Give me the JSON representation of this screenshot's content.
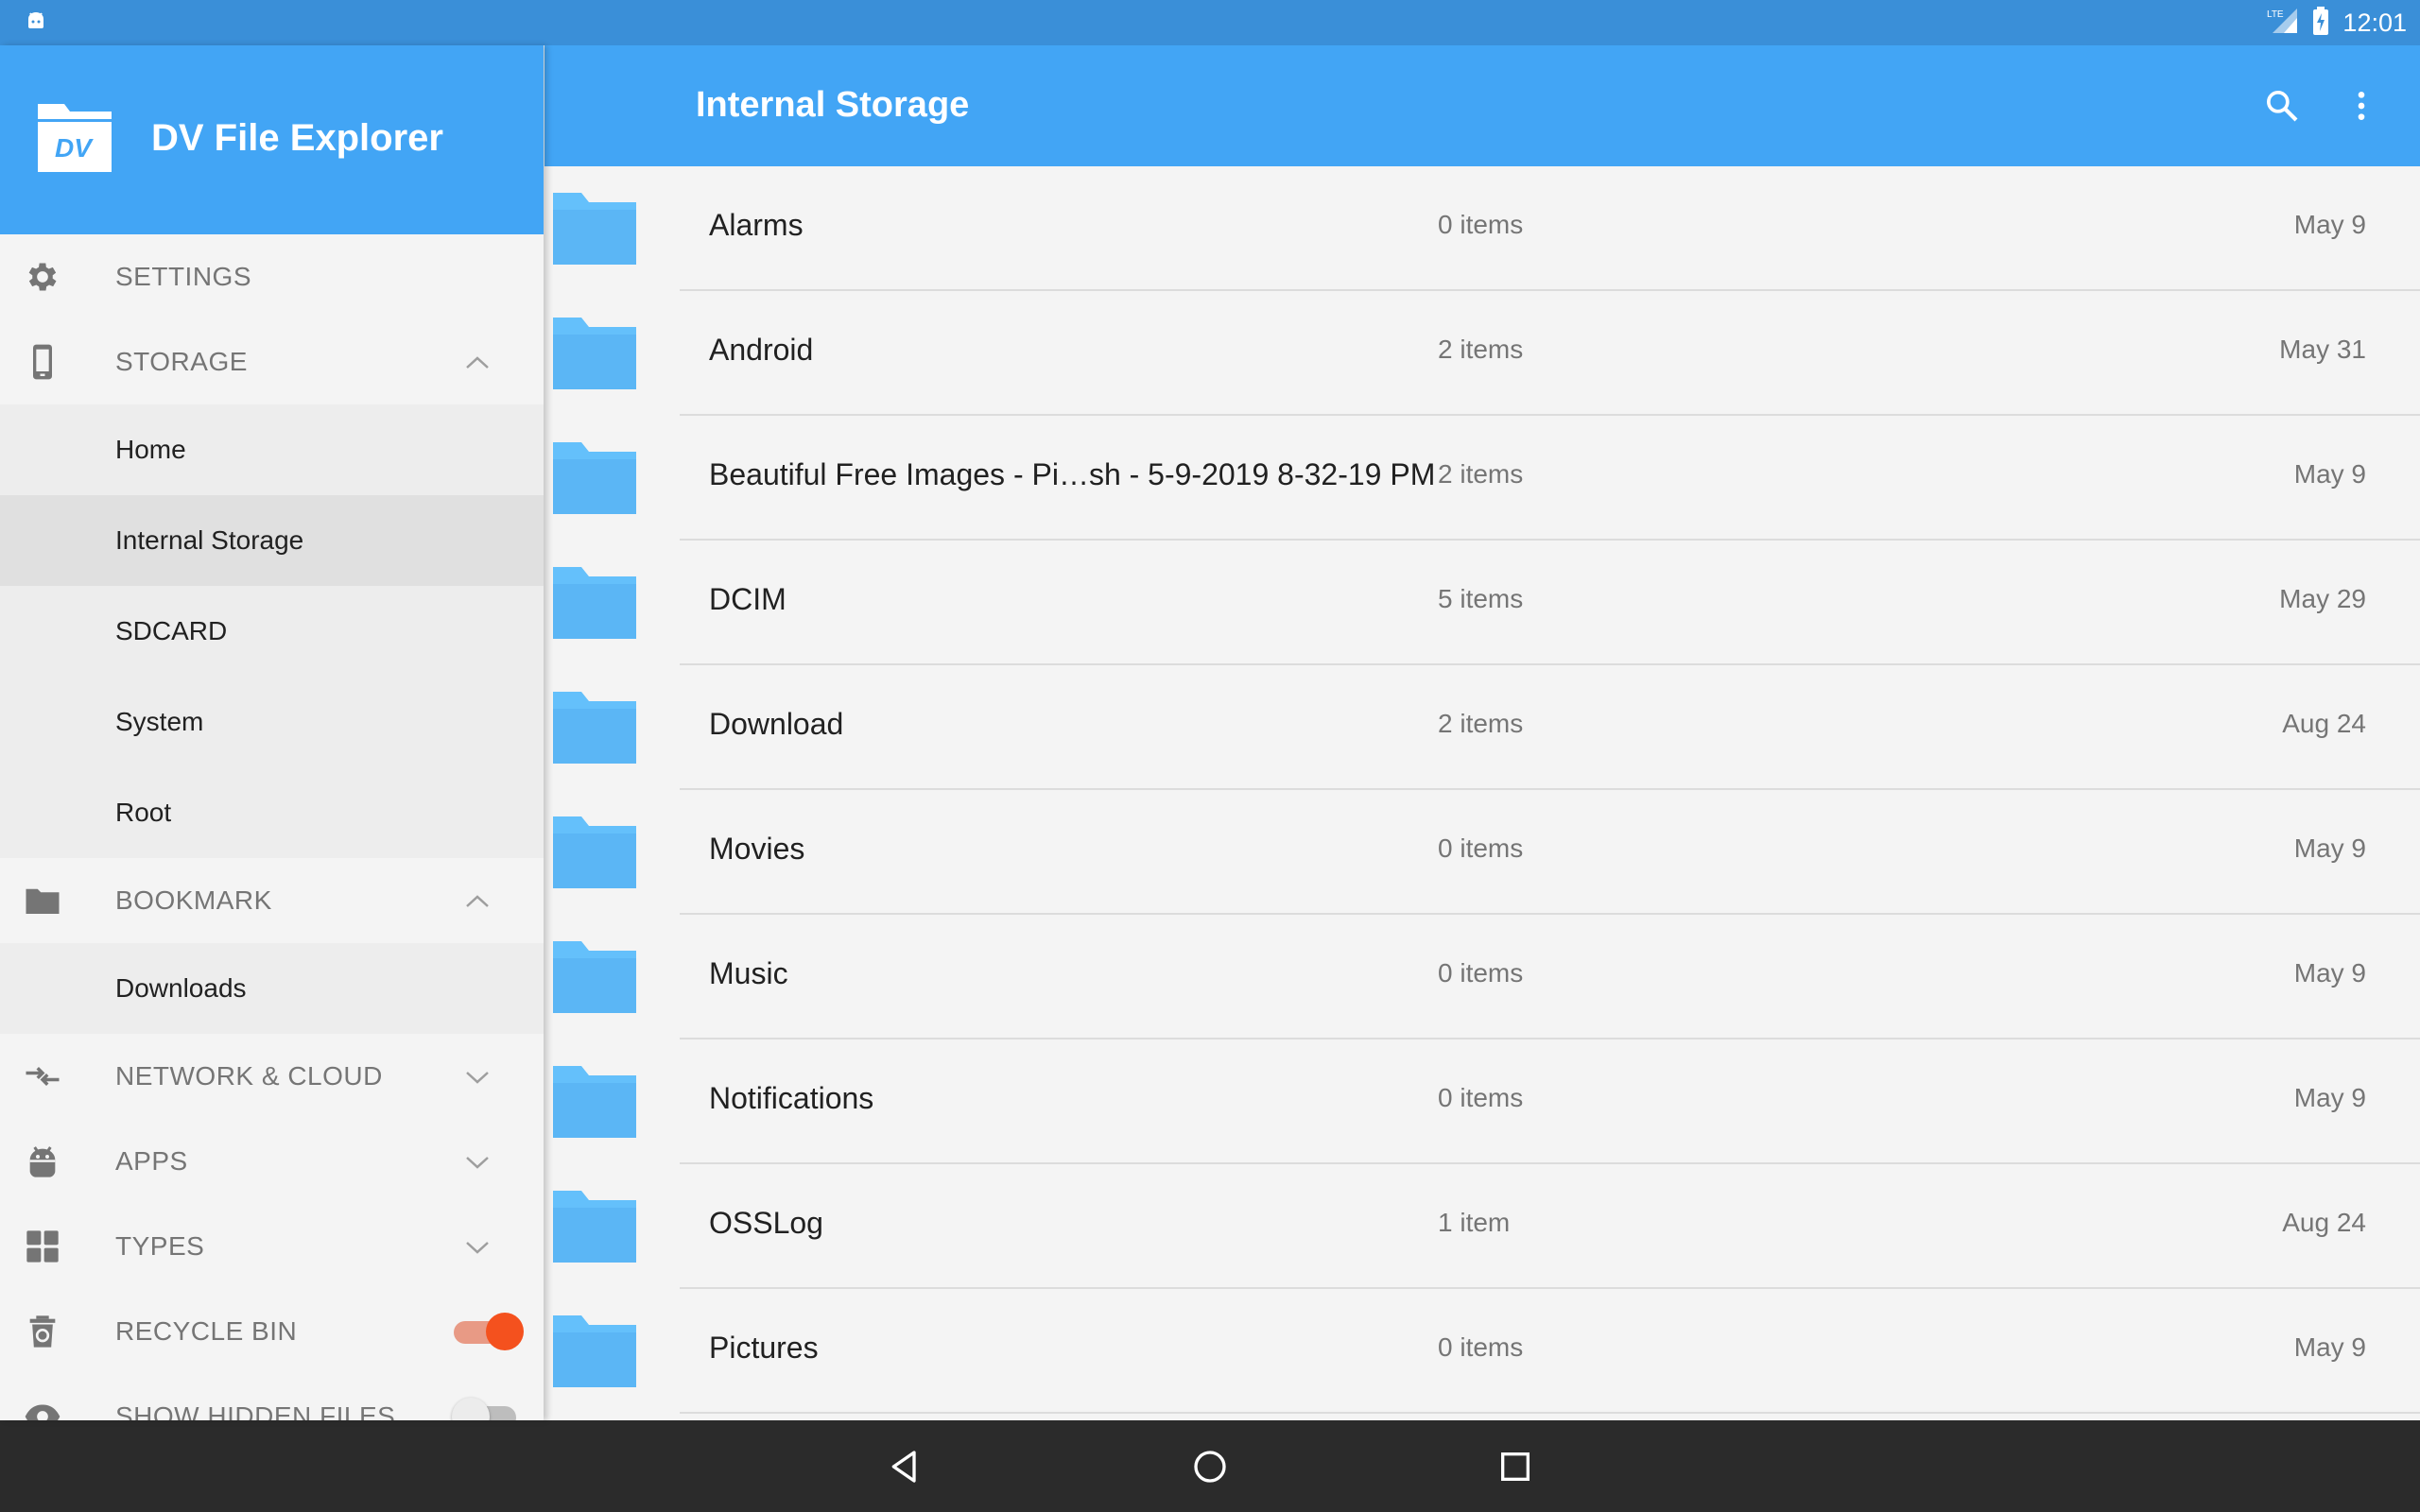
{
  "status_bar": {
    "time": "12:01",
    "network": "LTE",
    "icons": [
      "android-icon",
      "signal-icon",
      "battery-icon"
    ]
  },
  "app": {
    "name": "DV File Explorer",
    "logo_text": "DV"
  },
  "drawer": {
    "settings": "SETTINGS",
    "storage": {
      "label": "STORAGE",
      "items": [
        "Home",
        "Internal Storage",
        "SDCARD",
        "System",
        "Root"
      ],
      "selected": "Internal Storage"
    },
    "bookmark": {
      "label": "BOOKMARK",
      "items": [
        "Downloads"
      ]
    },
    "network": "NETWORK & CLOUD",
    "apps": "APPS",
    "types": "TYPES",
    "recycle_bin": {
      "label": "RECYCLE BIN",
      "enabled": true
    },
    "show_hidden": {
      "label": "SHOW HIDDEN FILES",
      "enabled": false
    }
  },
  "toolbar": {
    "title": "Internal Storage",
    "icons": [
      "search-icon",
      "more-vert-icon"
    ]
  },
  "files": [
    {
      "name": "Alarms",
      "count": "0 items",
      "date": "May 9"
    },
    {
      "name": "Android",
      "count": "2 items",
      "date": "May 31"
    },
    {
      "name": "Beautiful Free Images - Pi…sh - 5-9-2019 8-32-19 PM",
      "count": "2 items",
      "date": "May 9"
    },
    {
      "name": "DCIM",
      "count": "5 items",
      "date": "May 29"
    },
    {
      "name": "Download",
      "count": "2 items",
      "date": "Aug 24"
    },
    {
      "name": "Movies",
      "count": "0 items",
      "date": "May 9"
    },
    {
      "name": "Music",
      "count": "0 items",
      "date": "May 9"
    },
    {
      "name": "Notifications",
      "count": "0 items",
      "date": "May 9"
    },
    {
      "name": "OSSLog",
      "count": "1 item",
      "date": "Aug 24"
    },
    {
      "name": "Pictures",
      "count": "0 items",
      "date": "May 9"
    }
  ],
  "colors": {
    "primary": "#42a5f5",
    "status_bar": "#3a8fd8",
    "folder": "#64c0fb",
    "toggle_on": "#f4511e",
    "nav_bar": "#2b2b2b"
  },
  "navigation": {
    "buttons": [
      "back-icon",
      "home-icon",
      "recents-icon"
    ]
  }
}
